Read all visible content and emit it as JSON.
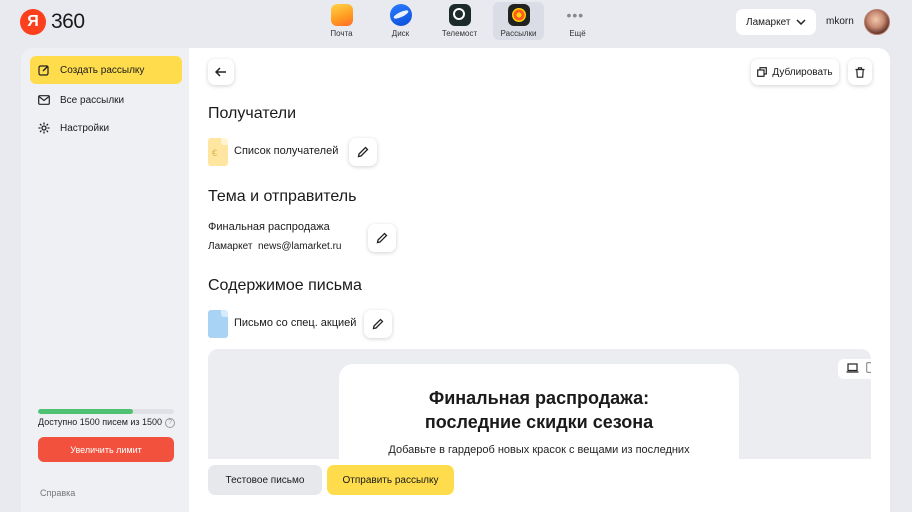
{
  "header": {
    "logo_letter": "Я",
    "logo_text": "360",
    "apps": [
      {
        "label": "Почта",
        "icon": "mail-icon"
      },
      {
        "label": "Диск",
        "icon": "disk-icon"
      },
      {
        "label": "Телемост",
        "icon": "telemost-icon"
      },
      {
        "label": "Рассылки",
        "icon": "rassylki-icon",
        "active": true
      },
      {
        "label": "Ещё",
        "icon": "more-dots-icon"
      }
    ],
    "org": "Ламаркет",
    "username": "mkorn"
  },
  "sidebar": {
    "items": [
      {
        "label": "Создать рассылку",
        "icon": "edit-square-icon"
      },
      {
        "label": "Все рассылки",
        "icon": "envelope-icon"
      },
      {
        "label": "Настройки",
        "icon": "gear-icon"
      }
    ],
    "limit": {
      "text": "Доступно 1500 писем из 1500",
      "fill_fraction": 0.7,
      "button": "Увеличить лимит"
    },
    "help": "Справка"
  },
  "main": {
    "duplicate_label": "Дублировать",
    "sections": {
      "recipients_title": "Получатели",
      "recipients_list": "Список получателей",
      "subject_title": "Тема и отправитель",
      "subject": "Финальная распродажа",
      "sender_name": "Ламаркет",
      "sender_email": "news@lamarket.ru",
      "content_title": "Содержимое письма",
      "content_doc": "Письмо со спец. акцией"
    },
    "preview": {
      "title_line1": "Финальная распродажа:",
      "title_line2": "последние скидки сезона",
      "subtitle": "Добавьте в гардероб новых красок с вещами из последних"
    },
    "actions": {
      "test": "Тестовое письмо",
      "send": "Отправить рассылку"
    }
  }
}
